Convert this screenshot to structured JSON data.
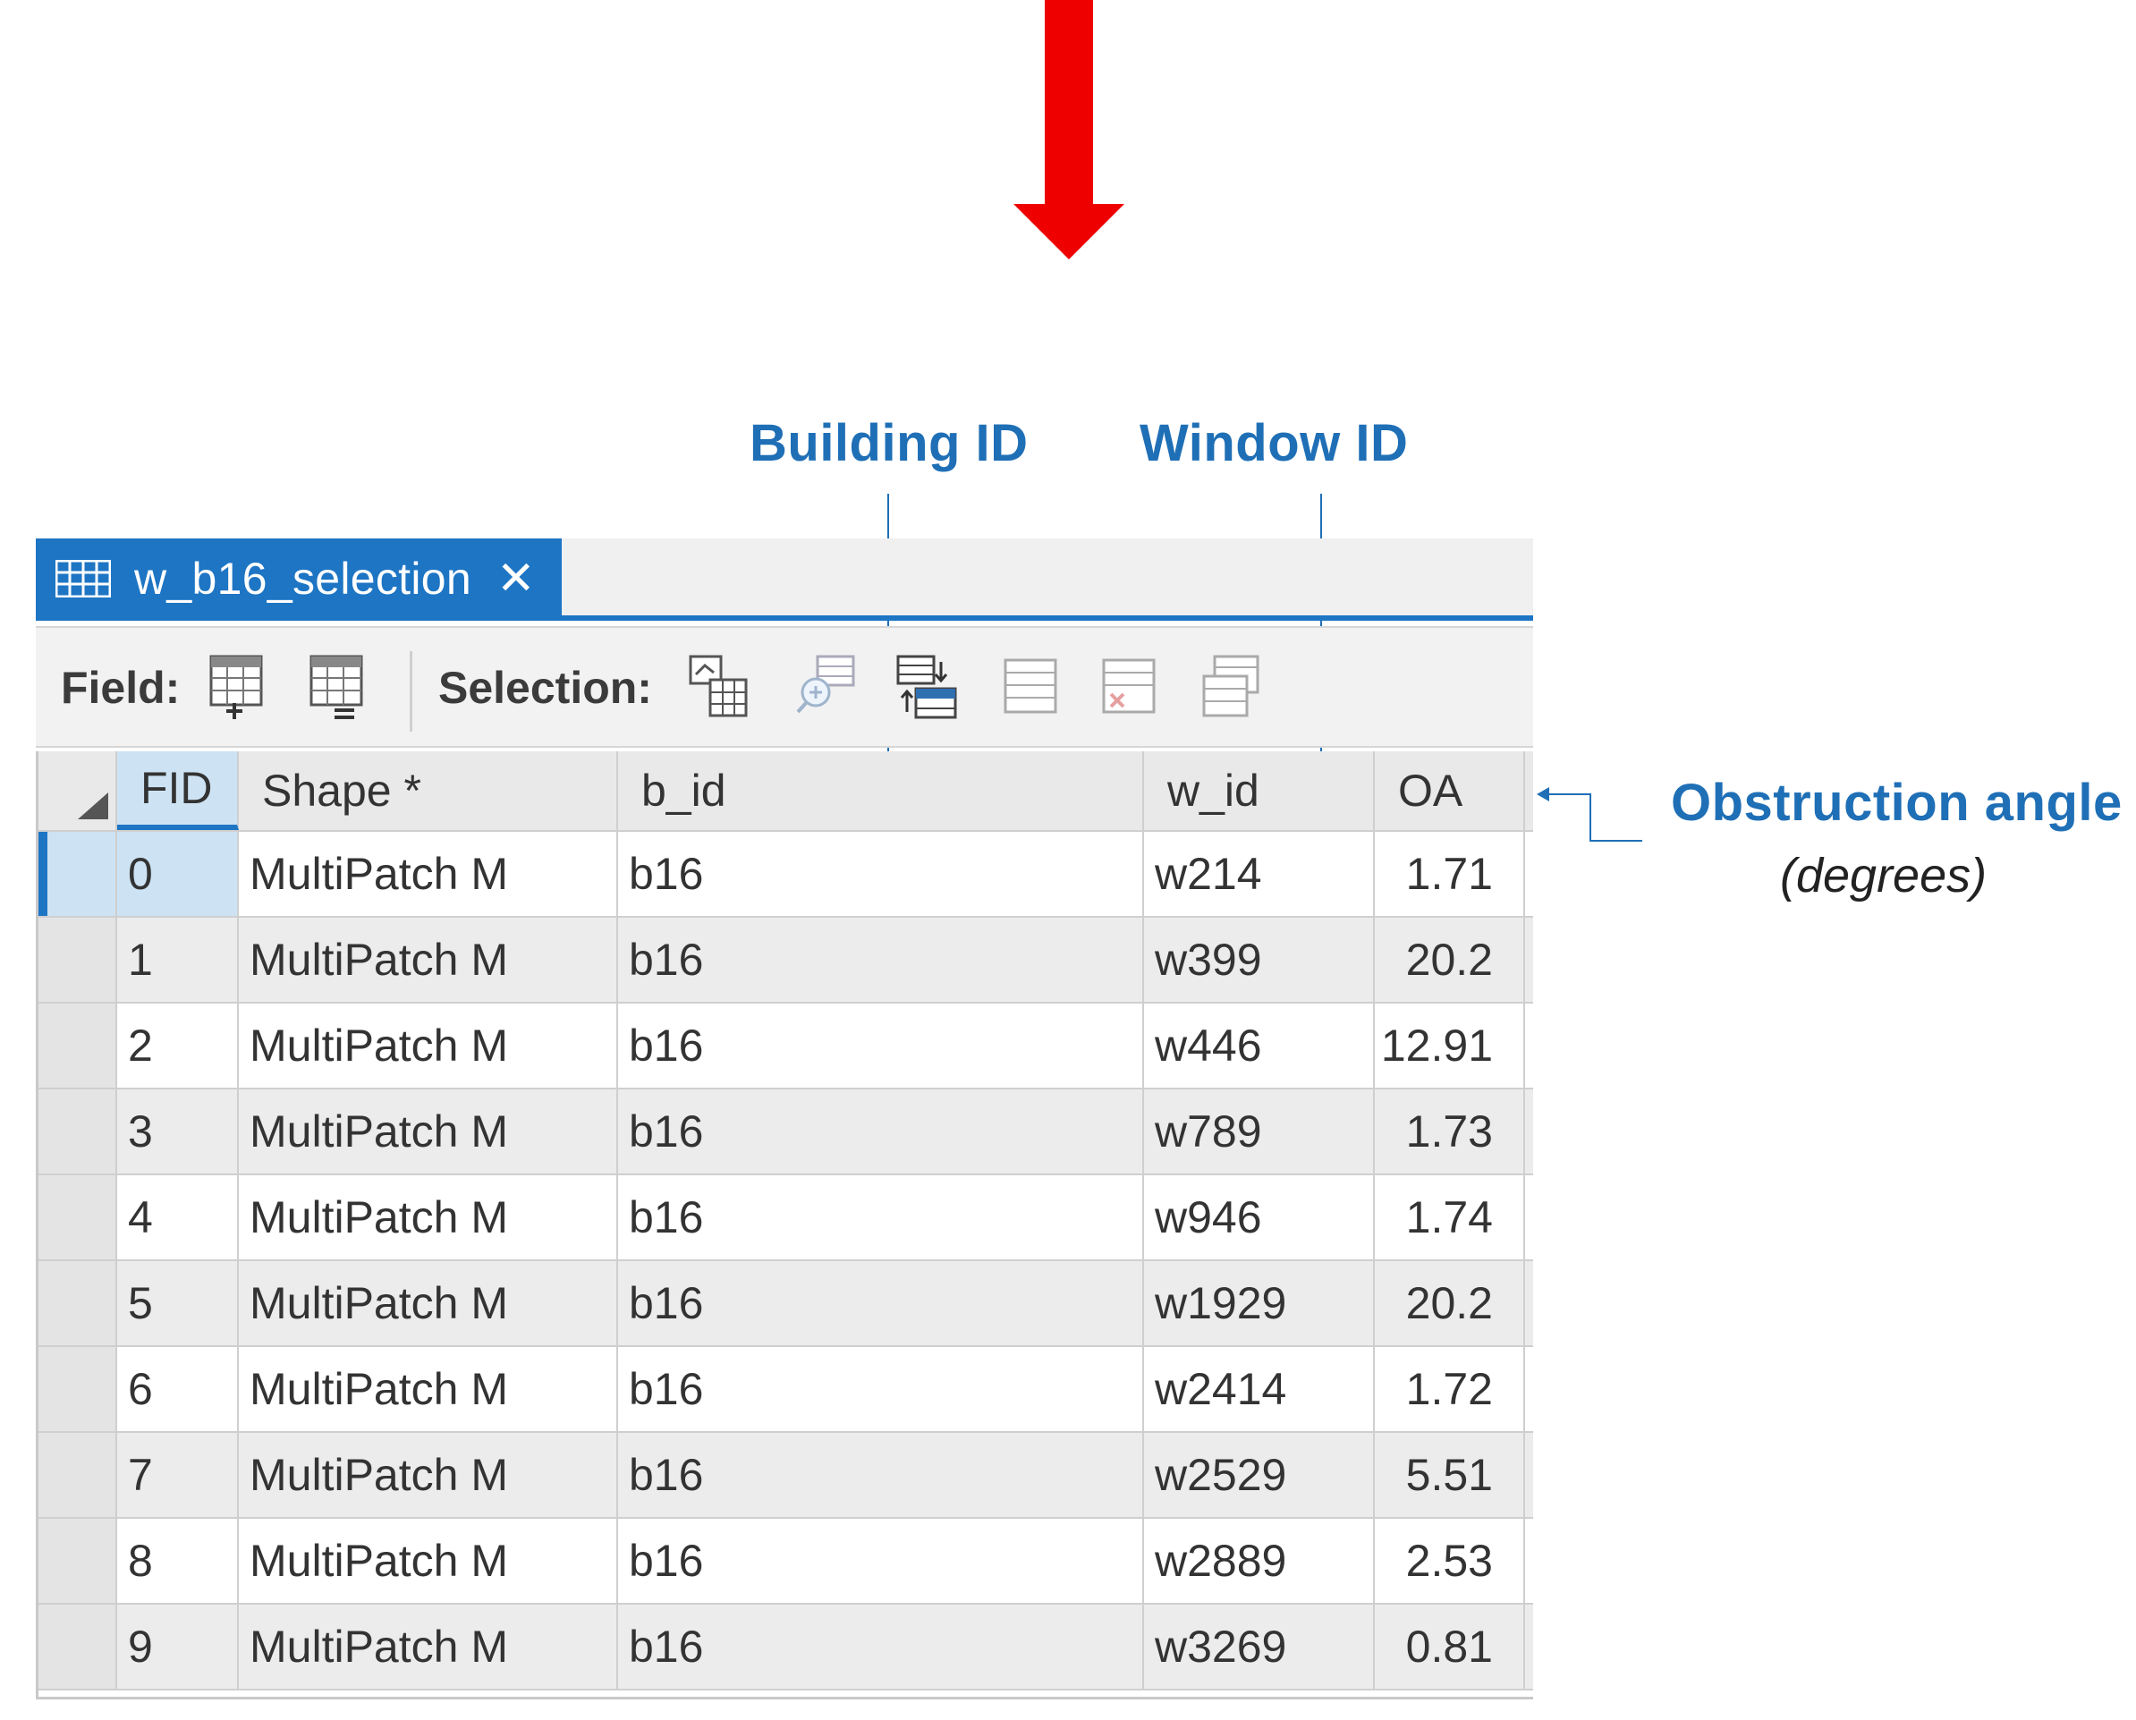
{
  "annotations": {
    "building_id": "Building ID",
    "window_id": "Window ID",
    "obstruction_angle": "Obstruction angle",
    "obstruction_angle_unit": "(degrees)"
  },
  "colors": {
    "accent": "#1d75c4",
    "callout": "#1f6fb6",
    "arrow": "#ee0000"
  },
  "tab": {
    "icon": "table-icon",
    "title": "w_b16_selection",
    "close_label": "✕"
  },
  "toolbar": {
    "field_label": "Field:",
    "selection_label": "Selection:",
    "field_icons": [
      "add-field-icon",
      "calculate-field-icon"
    ],
    "selection_icons": [
      "select-by-attributes-icon",
      "zoom-to-selection-icon",
      "switch-selection-icon",
      "clear-selection-icon",
      "delete-selection-icon",
      "copy-selection-icon"
    ]
  },
  "table": {
    "columns": [
      "FID",
      "Shape *",
      "b_id",
      "w_id",
      "OA"
    ],
    "rows": [
      {
        "fid": "0",
        "shape": "MultiPatch M",
        "b_id": "b16",
        "w_id": "w214",
        "oa": "1.71"
      },
      {
        "fid": "1",
        "shape": "MultiPatch M",
        "b_id": "b16",
        "w_id": "w399",
        "oa": "20.2"
      },
      {
        "fid": "2",
        "shape": "MultiPatch M",
        "b_id": "b16",
        "w_id": "w446",
        "oa": "12.91"
      },
      {
        "fid": "3",
        "shape": "MultiPatch M",
        "b_id": "b16",
        "w_id": "w789",
        "oa": "1.73"
      },
      {
        "fid": "4",
        "shape": "MultiPatch M",
        "b_id": "b16",
        "w_id": "w946",
        "oa": "1.74"
      },
      {
        "fid": "5",
        "shape": "MultiPatch M",
        "b_id": "b16",
        "w_id": "w1929",
        "oa": "20.2"
      },
      {
        "fid": "6",
        "shape": "MultiPatch M",
        "b_id": "b16",
        "w_id": "w2414",
        "oa": "1.72"
      },
      {
        "fid": "7",
        "shape": "MultiPatch M",
        "b_id": "b16",
        "w_id": "w2529",
        "oa": "5.51"
      },
      {
        "fid": "8",
        "shape": "MultiPatch M",
        "b_id": "b16",
        "w_id": "w2889",
        "oa": "2.53"
      },
      {
        "fid": "9",
        "shape": "MultiPatch M",
        "b_id": "b16",
        "w_id": "w3269",
        "oa": "0.81"
      }
    ]
  }
}
